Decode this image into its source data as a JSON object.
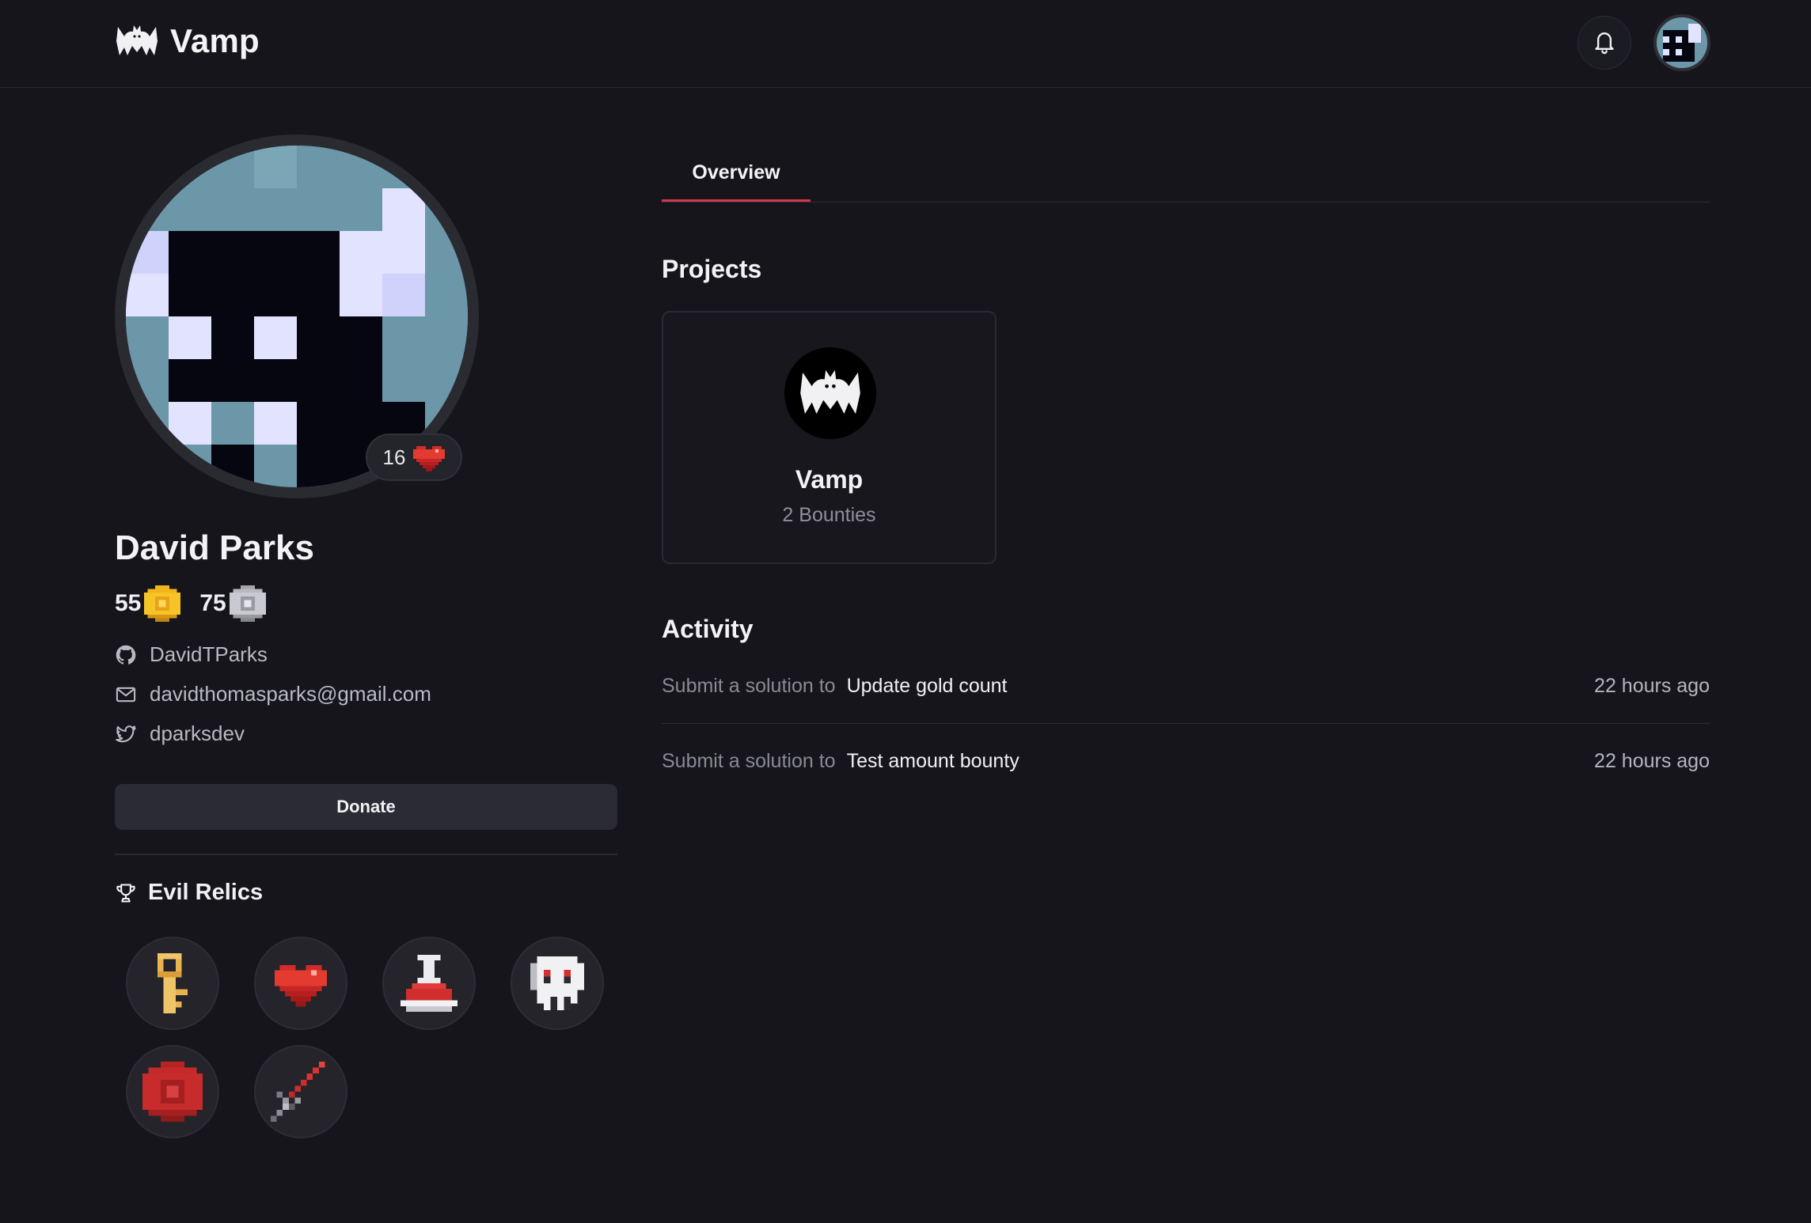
{
  "header": {
    "brand": "Vamp",
    "bell_icon": "bell-icon",
    "brand_icon": "bat-logo-icon"
  },
  "profile": {
    "heart_count": "16",
    "name": "David Parks",
    "gold_coins": "55",
    "silver_coins": "75",
    "github": "DavidTParks",
    "email": "davidthomasparks@gmail.com",
    "twitter": "dparksdev",
    "donate_label": "Donate",
    "relics_title": "Evil Relics",
    "relics": [
      "key",
      "heart",
      "potion",
      "skull",
      "red-orb",
      "sword"
    ]
  },
  "tabs": {
    "overview": "Overview"
  },
  "projects": {
    "title": "Projects",
    "items": [
      {
        "name": "Vamp",
        "bounties": "2 Bounties"
      }
    ]
  },
  "activity": {
    "title": "Activity",
    "items": [
      {
        "prefix": "Submit a solution to",
        "link": "Update gold count",
        "time": "22 hours ago"
      },
      {
        "prefix": "Submit a solution to",
        "link": "Test amount bounty",
        "time": "22 hours ago"
      }
    ]
  },
  "colors": {
    "background": "#15151b",
    "accent": "#d0394a",
    "avatar_bg": "#6b97a9"
  }
}
